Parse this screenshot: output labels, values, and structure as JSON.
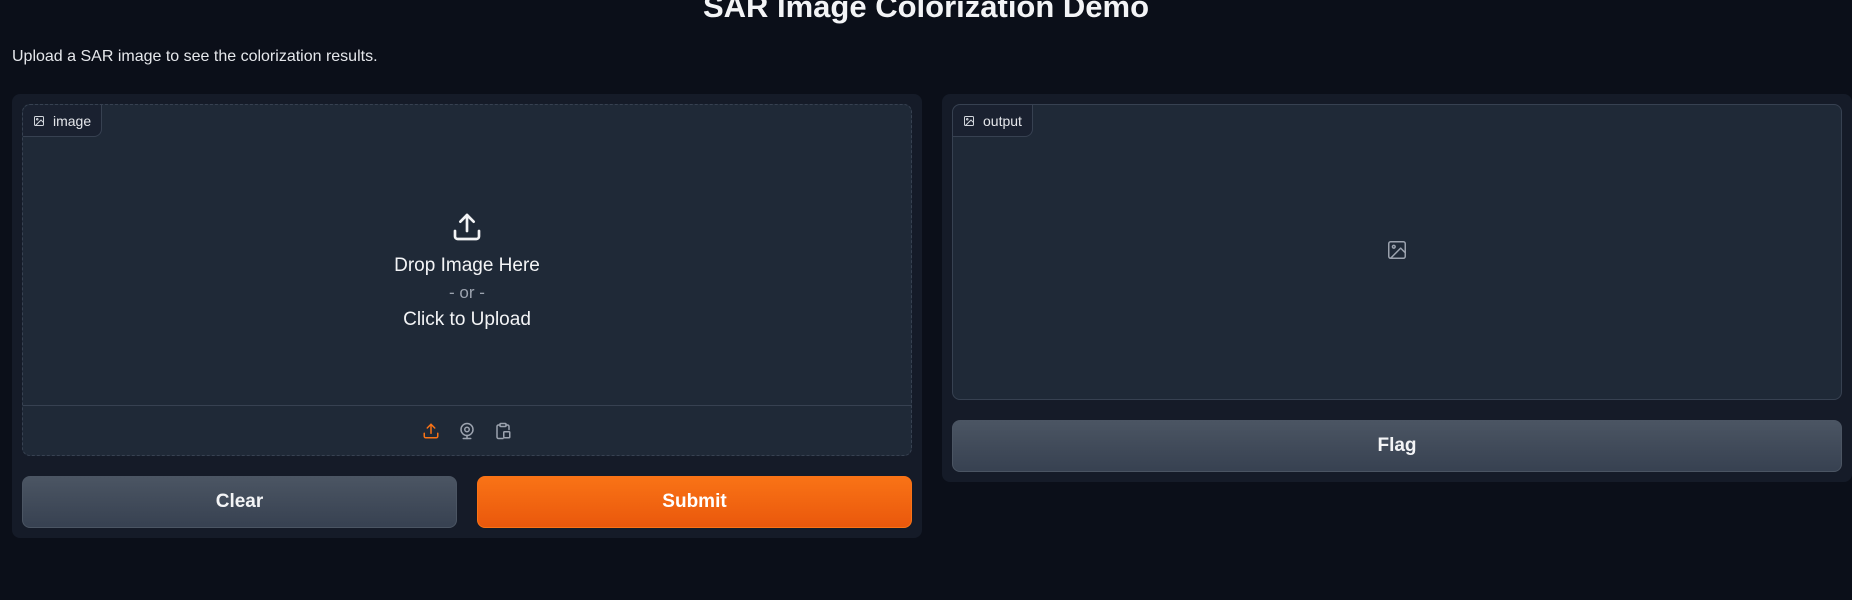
{
  "header": {
    "title": "SAR Image Colorization Demo",
    "description": "Upload a SAR image to see the colorization results."
  },
  "input": {
    "label": "image",
    "label_icon": "image-icon",
    "drop_text": "Drop Image Here",
    "or_text": "- or -",
    "click_text": "Click to Upload",
    "sources": [
      {
        "name": "upload",
        "icon": "upload-icon",
        "active": true
      },
      {
        "name": "webcam",
        "icon": "webcam-icon",
        "active": false
      },
      {
        "name": "clipboard",
        "icon": "clipboard-icon",
        "active": false
      }
    ]
  },
  "buttons": {
    "clear_label": "Clear",
    "submit_label": "Submit",
    "flag_label": "Flag"
  },
  "output": {
    "label": "output",
    "label_icon": "image-icon",
    "placeholder_icon": "image-placeholder-icon"
  },
  "colors": {
    "accent": "#f97316",
    "background": "#0b0f19",
    "panel": "#151b28",
    "block": "#1f2937"
  }
}
